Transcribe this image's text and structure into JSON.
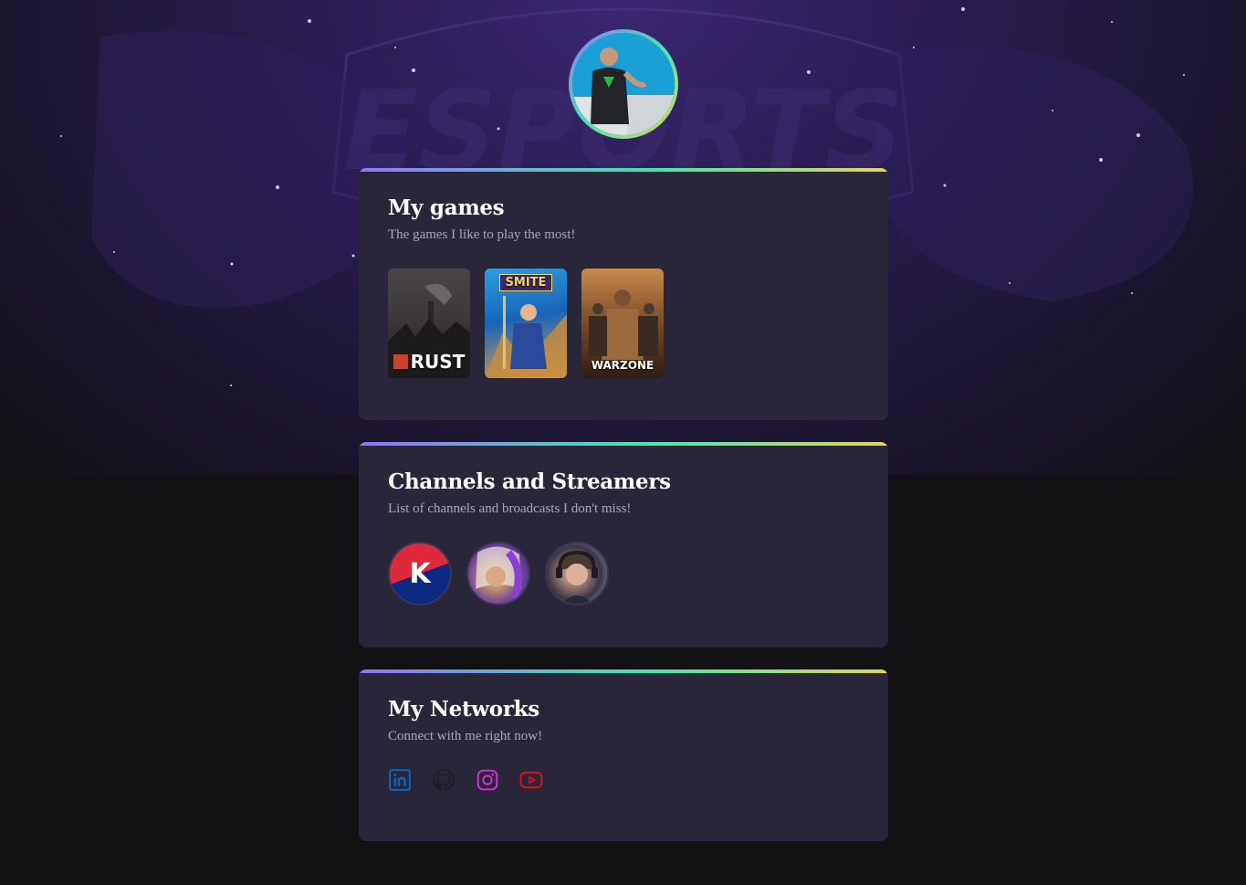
{
  "background": {
    "watermark": "ESPORTS"
  },
  "profile": {
    "avatar_alt": "profile photo"
  },
  "games_card": {
    "title": "My games",
    "subtitle": "The games I like to play the most!",
    "games": [
      {
        "name": "RUST"
      },
      {
        "name": "SMITE"
      },
      {
        "name": "WARZONE"
      }
    ]
  },
  "channels_card": {
    "title": "Channels and Streamers",
    "subtitle": "List of channels and broadcasts I don't miss!",
    "channels": [
      {
        "initial": "K"
      }
    ]
  },
  "networks_card": {
    "title": "My Networks",
    "subtitle": "Connect with me right now!",
    "networks": [
      {
        "icon": "linkedin-icon",
        "color": "#0a66c2"
      },
      {
        "icon": "github-icon",
        "color": "#1f1f22"
      },
      {
        "icon": "instagram-icon",
        "color": "#d62fd9"
      },
      {
        "icon": "youtube-icon",
        "color": "#e10d16"
      }
    ]
  }
}
